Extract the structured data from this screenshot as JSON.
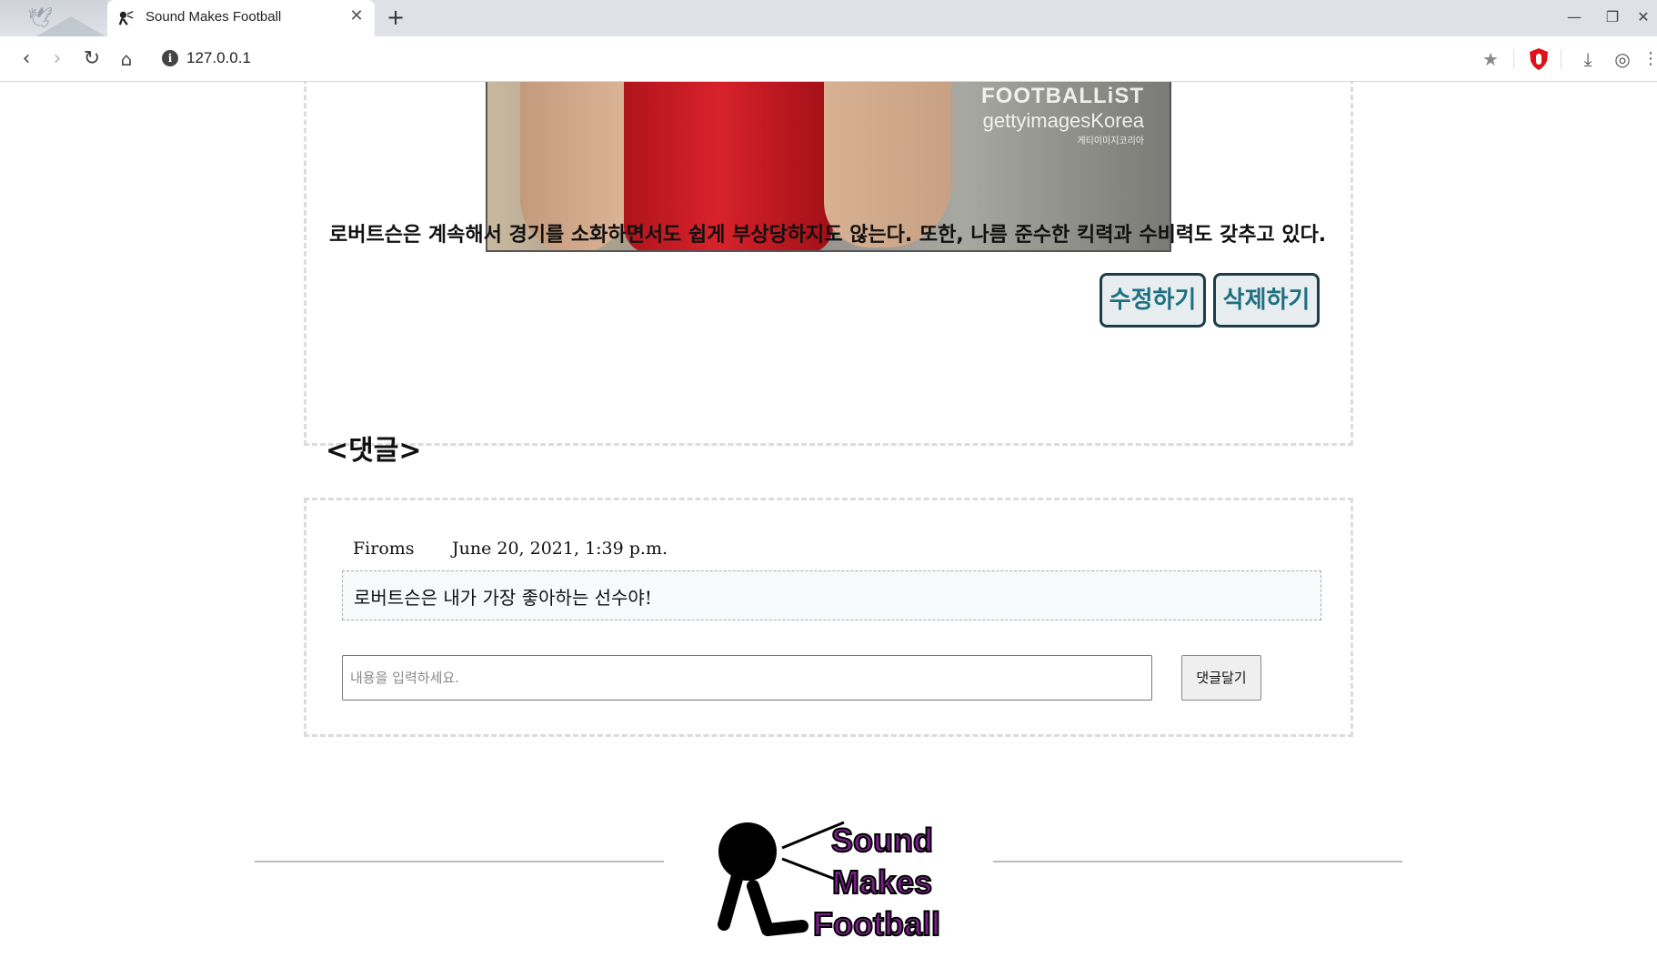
{
  "browser": {
    "tab_title": "Sound Makes Football",
    "tab_close": "✕",
    "new_tab": "+",
    "address": "127.0.0.1",
    "win_minimize": "—",
    "win_restore": "❐",
    "win_close": "✕"
  },
  "post": {
    "image_brand": "FOOTBALLiST",
    "image_credit": "gettyimagesKorea",
    "image_credit_sub": "게티이미지코리아",
    "body": "로버트슨은 계속해서 경기를 소화하면서도 쉽게 부상당하지도 않는다. 또한, 나름 준수한 킥력과 수비력도 갖추고 있다.",
    "edit_label": "수정하기",
    "delete_label": "삭제하기"
  },
  "comments": {
    "heading": "<댓글>",
    "items": [
      {
        "author": "Firoms",
        "date": "June 20, 2021, 1:39 p.m.",
        "content": "로버트슨은 내가 가장 좋아하는 선수야!"
      }
    ],
    "input_placeholder": "내용을 입력하세요.",
    "submit_label": "댓글달기"
  },
  "footer": {
    "logo_word1": "Sound",
    "logo_word2": "Makes",
    "logo_word3": "Football",
    "logo_color": "#7a1f8a"
  }
}
